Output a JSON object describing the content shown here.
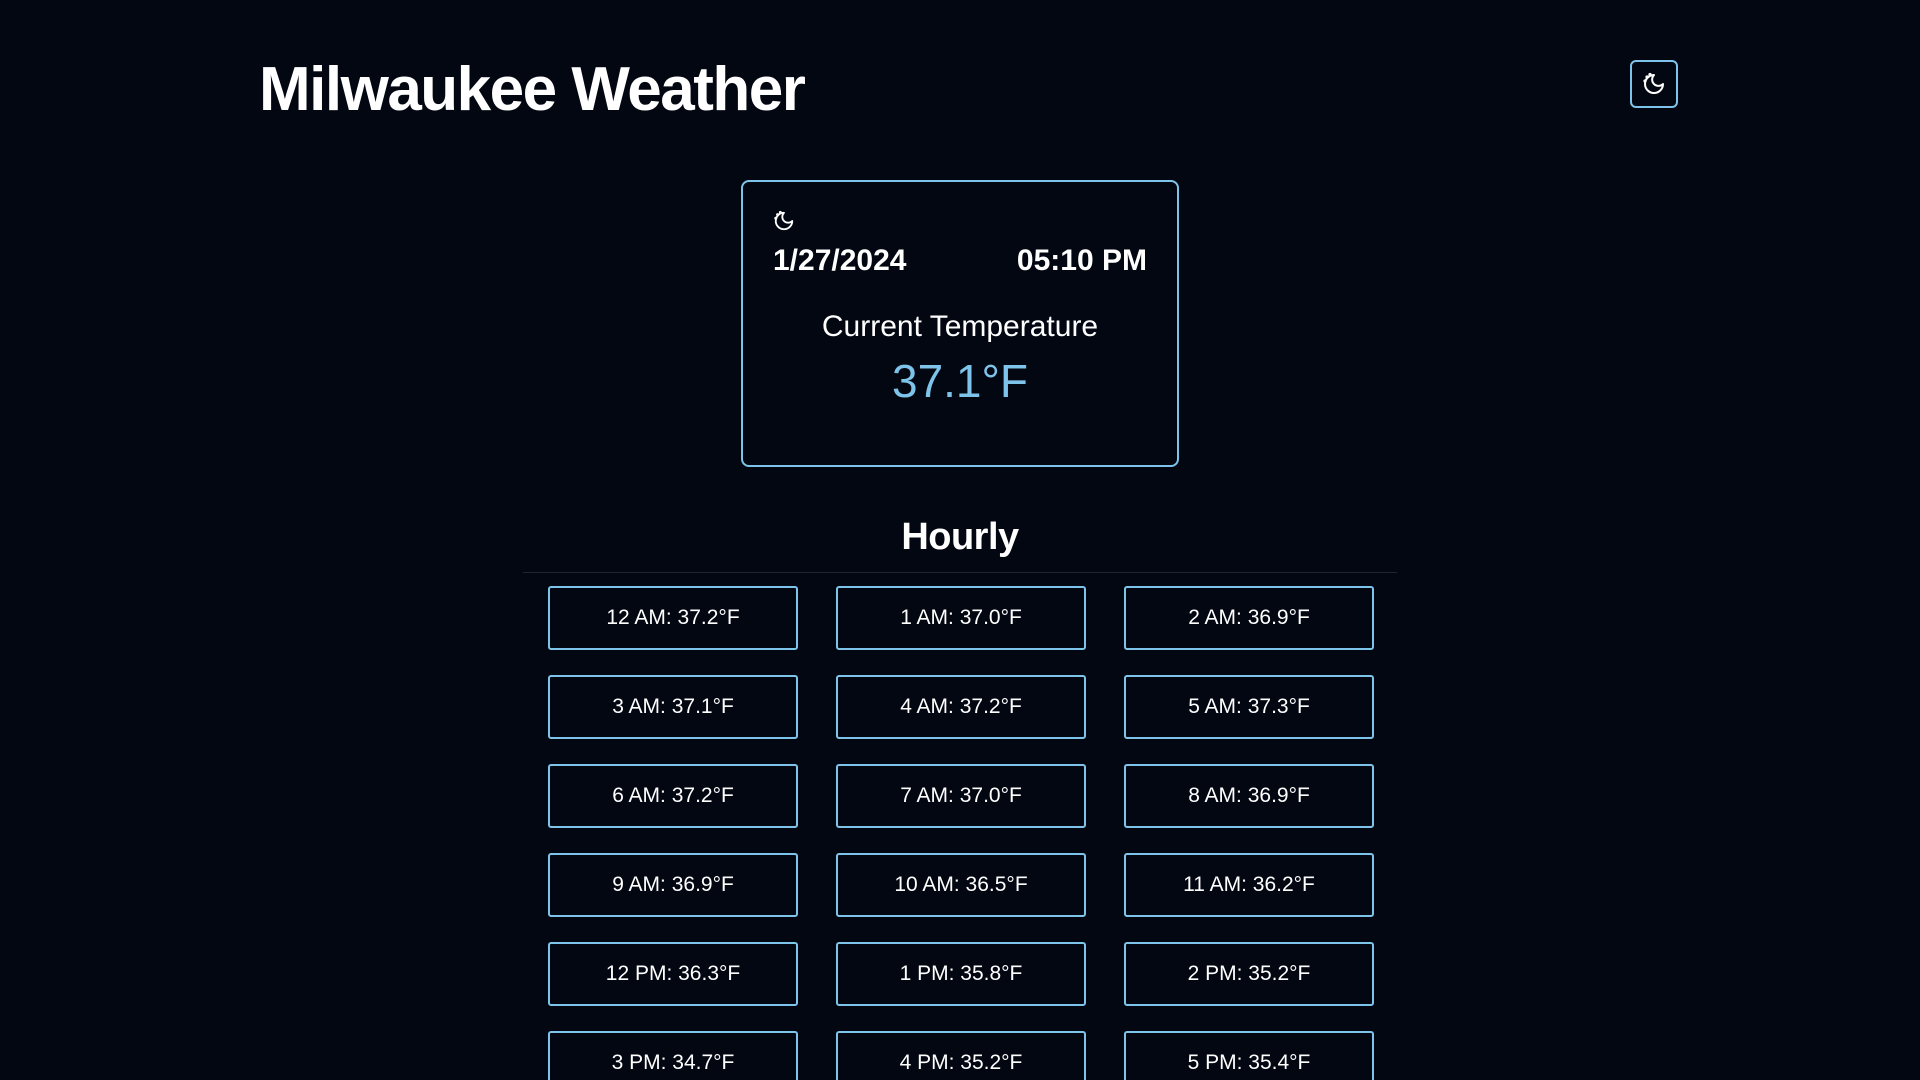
{
  "header": {
    "title": "Milwaukee Weather",
    "theme_toggle_icon": "moon-icon"
  },
  "current": {
    "icon": "moon-icon",
    "date": "1/27/2024",
    "time": "05:10 PM",
    "label": "Current Temperature",
    "temperature": "37.1°F"
  },
  "hourly": {
    "title": "Hourly",
    "items": [
      {
        "label": "12 AM: 37.2°F"
      },
      {
        "label": "1 AM: 37.0°F"
      },
      {
        "label": "2 AM: 36.9°F"
      },
      {
        "label": "3 AM: 37.1°F"
      },
      {
        "label": "4 AM: 37.2°F"
      },
      {
        "label": "5 AM: 37.3°F"
      },
      {
        "label": "6 AM: 37.2°F"
      },
      {
        "label": "7 AM: 37.0°F"
      },
      {
        "label": "8 AM: 36.9°F"
      },
      {
        "label": "9 AM: 36.9°F"
      },
      {
        "label": "10 AM: 36.5°F"
      },
      {
        "label": "11 AM: 36.2°F"
      },
      {
        "label": "12 PM: 36.3°F"
      },
      {
        "label": "1 PM: 35.8°F"
      },
      {
        "label": "2 PM: 35.2°F"
      },
      {
        "label": "3 PM: 34.7°F"
      },
      {
        "label": "4 PM: 35.2°F"
      },
      {
        "label": "5 PM: 35.4°F"
      }
    ]
  },
  "colors": {
    "background": "#030712",
    "accent": "#7ec4ea",
    "text": "#ffffff"
  }
}
